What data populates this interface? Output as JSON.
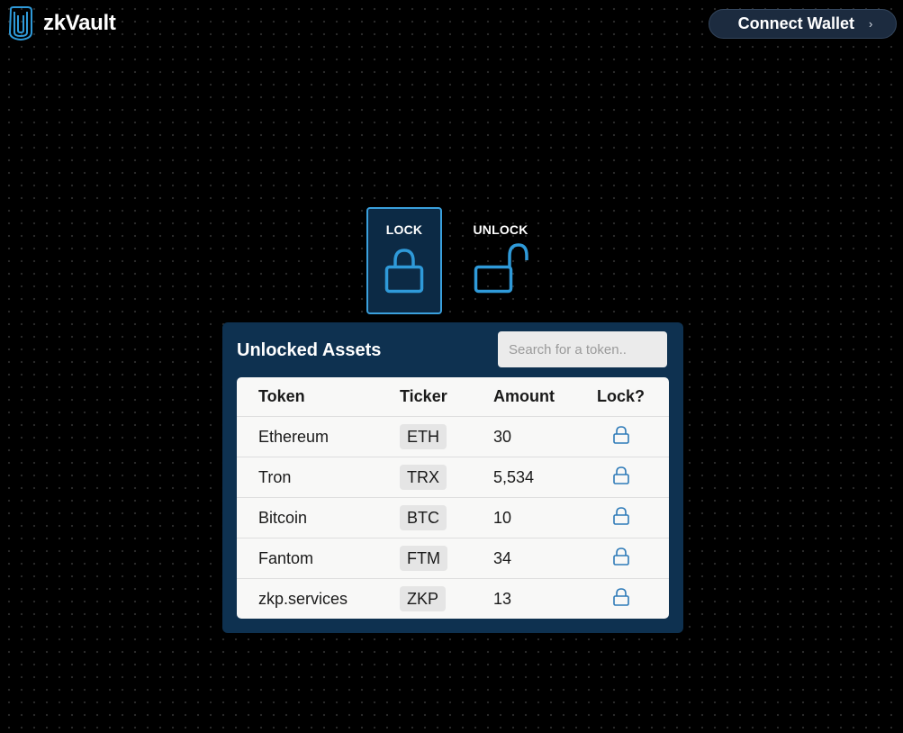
{
  "header": {
    "app_name": "zkVault",
    "logo_icon": "vault-shield-icon",
    "connect_wallet_label": "Connect Wallet",
    "connect_wallet_chevron": "›"
  },
  "modes": {
    "lock": {
      "label": "LOCK",
      "icon": "lock-closed-icon",
      "selected": true
    },
    "unlock": {
      "label": "UNLOCK",
      "icon": "lock-open-icon",
      "selected": false
    }
  },
  "assets_panel": {
    "title": "Unlocked Assets",
    "search_placeholder": "Search for a token..",
    "search_value": "",
    "columns": {
      "token": "Token",
      "ticker": "Ticker",
      "amount": "Amount",
      "lock": "Lock?"
    },
    "rows": [
      {
        "token": "Ethereum",
        "ticker": "ETH",
        "amount": "30",
        "lock_icon": "lock-icon"
      },
      {
        "token": "Tron",
        "ticker": "TRX",
        "amount": "5,534",
        "lock_icon": "lock-icon"
      },
      {
        "token": "Bitcoin",
        "ticker": "BTC",
        "amount": "10",
        "lock_icon": "lock-icon"
      },
      {
        "token": "Fantom",
        "ticker": "FTM",
        "amount": "34",
        "lock_icon": "lock-icon"
      },
      {
        "token": "zkp.services",
        "ticker": "ZKP",
        "amount": "13",
        "lock_icon": "lock-icon"
      }
    ]
  },
  "colors": {
    "background": "#000000",
    "accent": "#2f9ad9",
    "panel": "#0e3150",
    "lock_card": "#0c2a45",
    "button": "#1c2b3f"
  }
}
